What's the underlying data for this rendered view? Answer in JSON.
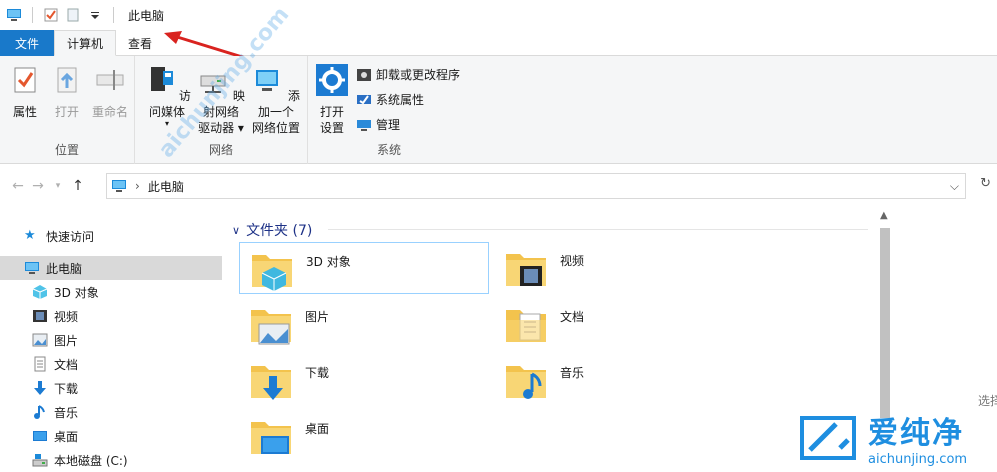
{
  "window": {
    "title": "此电脑"
  },
  "tabs": {
    "file": "文件",
    "computer": "计算机",
    "view": "查看"
  },
  "ribbon": {
    "location": {
      "label": "位置",
      "properties": "属性",
      "open": "打开",
      "rename": "重命名"
    },
    "network": {
      "label": "网络",
      "access_media": "访问媒体",
      "map_drive_l1": "映射网络",
      "map_drive_l2": "驱动器",
      "add_location_l1": "添加一个",
      "add_location_l2": "网络位置"
    },
    "system": {
      "label": "系统",
      "open_settings_l1": "打开",
      "open_settings_l2": "设置",
      "uninstall": "卸载或更改程序",
      "sys_props": "系统属性",
      "manage": "管理"
    }
  },
  "address": {
    "path": "此电脑"
  },
  "nav": {
    "quick_access": "快速访问",
    "this_pc": "此电脑",
    "items": [
      "3D 对象",
      "视频",
      "图片",
      "文档",
      "下载",
      "音乐",
      "桌面",
      "本地磁盘 (C:)"
    ]
  },
  "content": {
    "section_title": "文件夹 (7)",
    "folders": [
      {
        "name": "3D 对象",
        "icon": "3d-objects-folder-icon"
      },
      {
        "name": "视频",
        "icon": "videos-folder-icon"
      },
      {
        "name": "图片",
        "icon": "pictures-folder-icon"
      },
      {
        "name": "文档",
        "icon": "documents-folder-icon"
      },
      {
        "name": "下载",
        "icon": "downloads-folder-icon"
      },
      {
        "name": "音乐",
        "icon": "music-folder-icon"
      },
      {
        "name": "桌面",
        "icon": "desktop-folder-icon"
      }
    ]
  },
  "side_text": "选择",
  "watermark": {
    "brand": "爱纯净",
    "site": "aichunjing.com"
  },
  "colors": {
    "accent": "#1979ca",
    "folder": "#f3c34d",
    "annotation_arrow": "#d9231f"
  }
}
